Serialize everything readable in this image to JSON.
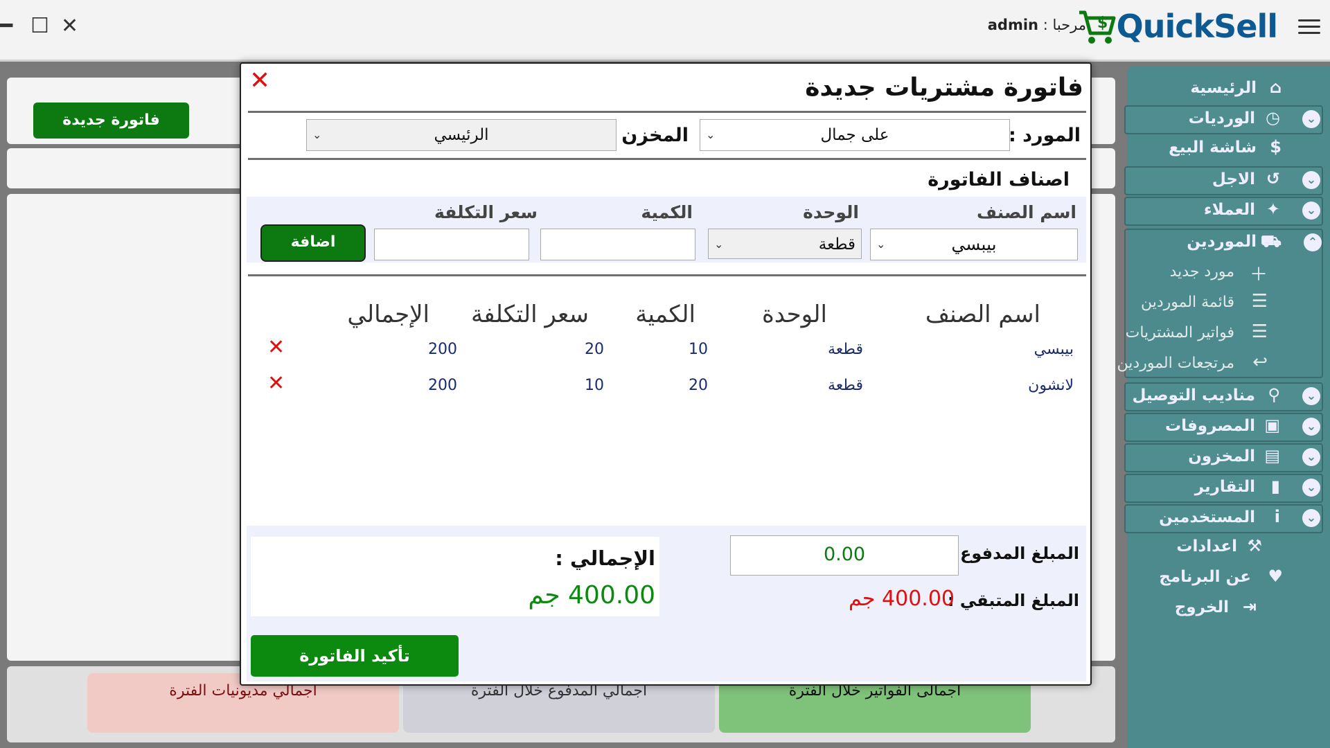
{
  "window": {
    "minimize": "━",
    "maximize": "☐",
    "close": "✕"
  },
  "header": {
    "logo": "QuickSell",
    "greeting_label": "مرحبا :",
    "username": "admin"
  },
  "background": {
    "new_invoice_button": "فاتورة جديدة",
    "cards": [
      {
        "label": "اجمالى الفواتير خلال الفترة",
        "color": "#7fc27a"
      },
      {
        "label": "اجمالي المدفوع خلال الفترة",
        "color": "#cfd0d8"
      },
      {
        "label": "اجمالي مديونيات الفترة",
        "color": "#f1c9c5"
      }
    ]
  },
  "sidebar": {
    "items": [
      {
        "label": "الرئيسية",
        "icon": "home-icon"
      },
      {
        "label": "الورديات",
        "icon": "clock-icon"
      },
      {
        "label": "شاشة البيع",
        "icon": "dollar-icon"
      },
      {
        "label": "الاجل",
        "icon": "history-icon"
      },
      {
        "label": "العملاء",
        "icon": "person-icon"
      },
      {
        "label": "الموردين",
        "icon": "truck-icon"
      },
      {
        "label": "مناديب التوصيل",
        "icon": "bike-icon"
      },
      {
        "label": "المصروفات",
        "icon": "money-icon"
      },
      {
        "label": "المخزون",
        "icon": "store-icon"
      },
      {
        "label": "التقارير",
        "icon": "book-icon"
      },
      {
        "label": "المستخدمين",
        "icon": "user-icon"
      },
      {
        "label": "اعدادات",
        "icon": "wrench-icon"
      },
      {
        "label": "عن البرنامج",
        "icon": "heart-icon"
      },
      {
        "label": "الخروج",
        "icon": "exit-icon"
      }
    ],
    "suppliers_sub": [
      {
        "label": "مورد جديد",
        "icon": "plus-icon"
      },
      {
        "label": "قائمة الموردين",
        "icon": "list-icon"
      },
      {
        "label": "فواتير المشتريات",
        "icon": "list-icon"
      },
      {
        "label": "مرتجعات الموردين",
        "icon": "return-icon"
      }
    ]
  },
  "modal": {
    "title": "فاتورة مشتريات جديدة",
    "supplier_label": "المورد :",
    "supplier_value": "على جمال",
    "store_label": "المخزن :",
    "store_value": "الرئيسي",
    "section_title": "اصناف الفاتورة",
    "add_form": {
      "item_label": "اسم الصنف",
      "item_value": "بيبسي",
      "unit_label": "الوحدة",
      "unit_value": "قطعة",
      "qty_label": "الكمية",
      "qty_value": "",
      "cost_label": "سعر التكلفة",
      "cost_value": "",
      "add_button": "اضافة"
    },
    "table": {
      "headers": [
        "اسم الصنف",
        "الوحدة",
        "الكمية",
        "سعر التكلفة",
        "الإجمالي"
      ],
      "rows": [
        {
          "item": "بيبسي",
          "unit": "قطعة",
          "qty": "10",
          "cost": "20",
          "total": "200"
        },
        {
          "item": "لانشون",
          "unit": "قطعة",
          "qty": "20",
          "cost": "10",
          "total": "200"
        }
      ]
    },
    "footer": {
      "paid_label": "المبلغ المدفوع :",
      "paid_value": "0.00",
      "remaining_label": "المبلغ المتبقي :",
      "remaining_value": "400.00 جم",
      "total_label": "الإجمالي :",
      "total_value": "400.00 جم",
      "confirm_button": "تأكيد الفاتورة"
    }
  },
  "colors": {
    "accent_green": "#0c7a10",
    "sidebar": "#4d8a8e",
    "danger": "#e01010",
    "brand": "#0d5a92"
  }
}
